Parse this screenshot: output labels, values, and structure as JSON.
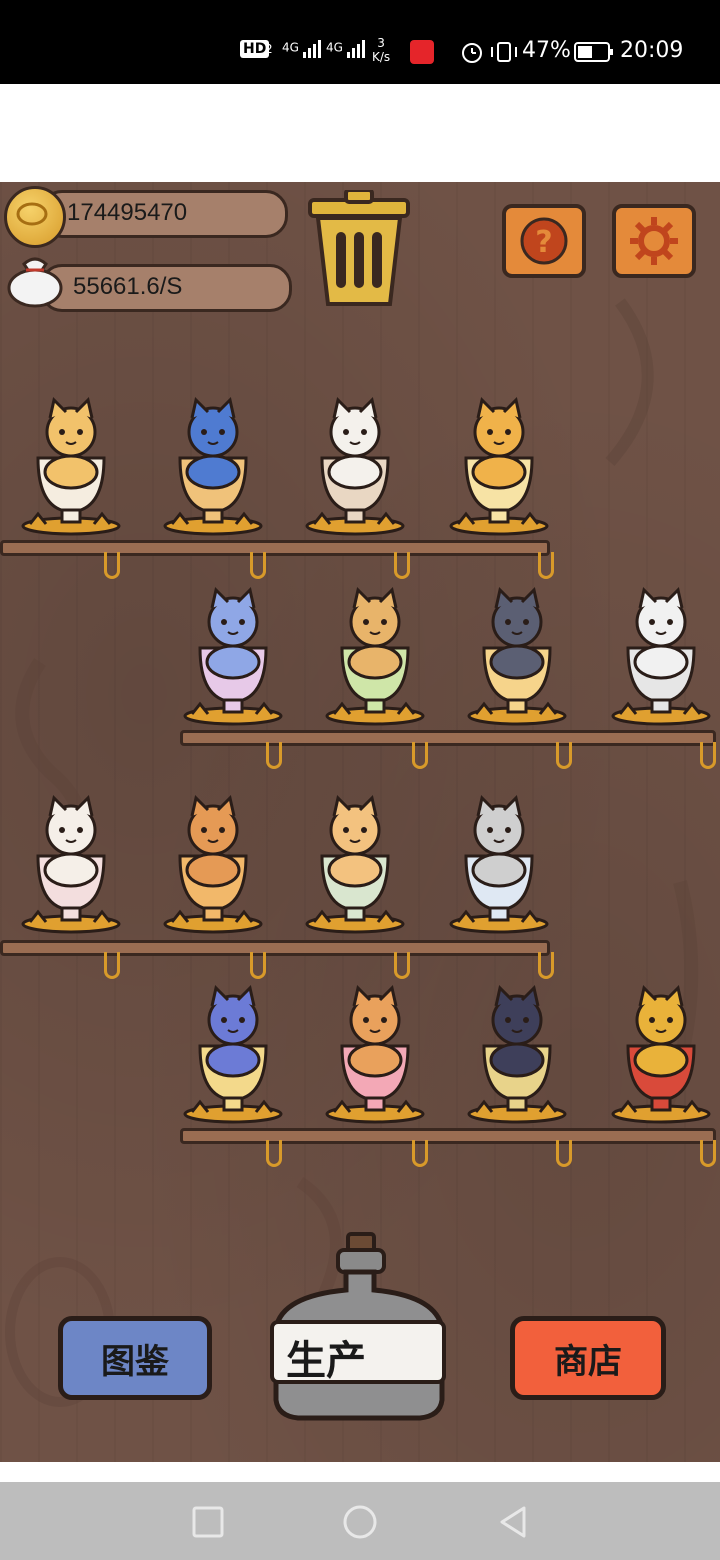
{
  "status_bar": {
    "hd_label": "HD",
    "signal_1": "4G",
    "signal_2": "4G",
    "net_speed_value": "3",
    "net_speed_unit": "K/s",
    "battery_percent": "47%",
    "time": "20:09"
  },
  "hud": {
    "coins": "174495470",
    "income_rate": "55661.6/S",
    "help_symbol": "?"
  },
  "shelves": [
    {
      "row": 1,
      "cats": [
        "crown-cat-teacup",
        "apple-hat-cat-mug",
        "red-jacket-cat-bowl",
        "sunglasses-cat-glass"
      ]
    },
    {
      "row": 2,
      "cats": [
        "sparkle-cat-goblet",
        "sunflower-cat-parfait",
        "twin-cats-beer-mug",
        "royal-cat-bowl"
      ]
    },
    {
      "row": 3,
      "cats": [
        "guitar-cat-sundae",
        "red-hat-cat-goblet",
        "scholar-cat-teacup",
        "plaid-cap-cat-glass"
      ]
    },
    {
      "row": 4,
      "cats": [
        "witch-hat-cat-beer",
        "lion-mane-cat-glass",
        "black-cat-grape-glass",
        "knight-cat-vase"
      ]
    }
  ],
  "buttons": {
    "collection": "图鉴",
    "produce": "生产",
    "shop": "商店"
  },
  "colors": {
    "wood": "#6f5246",
    "collection_btn": "#6d86c6",
    "shop_btn": "#f2603c",
    "gear_btn": "#e48a3a"
  }
}
